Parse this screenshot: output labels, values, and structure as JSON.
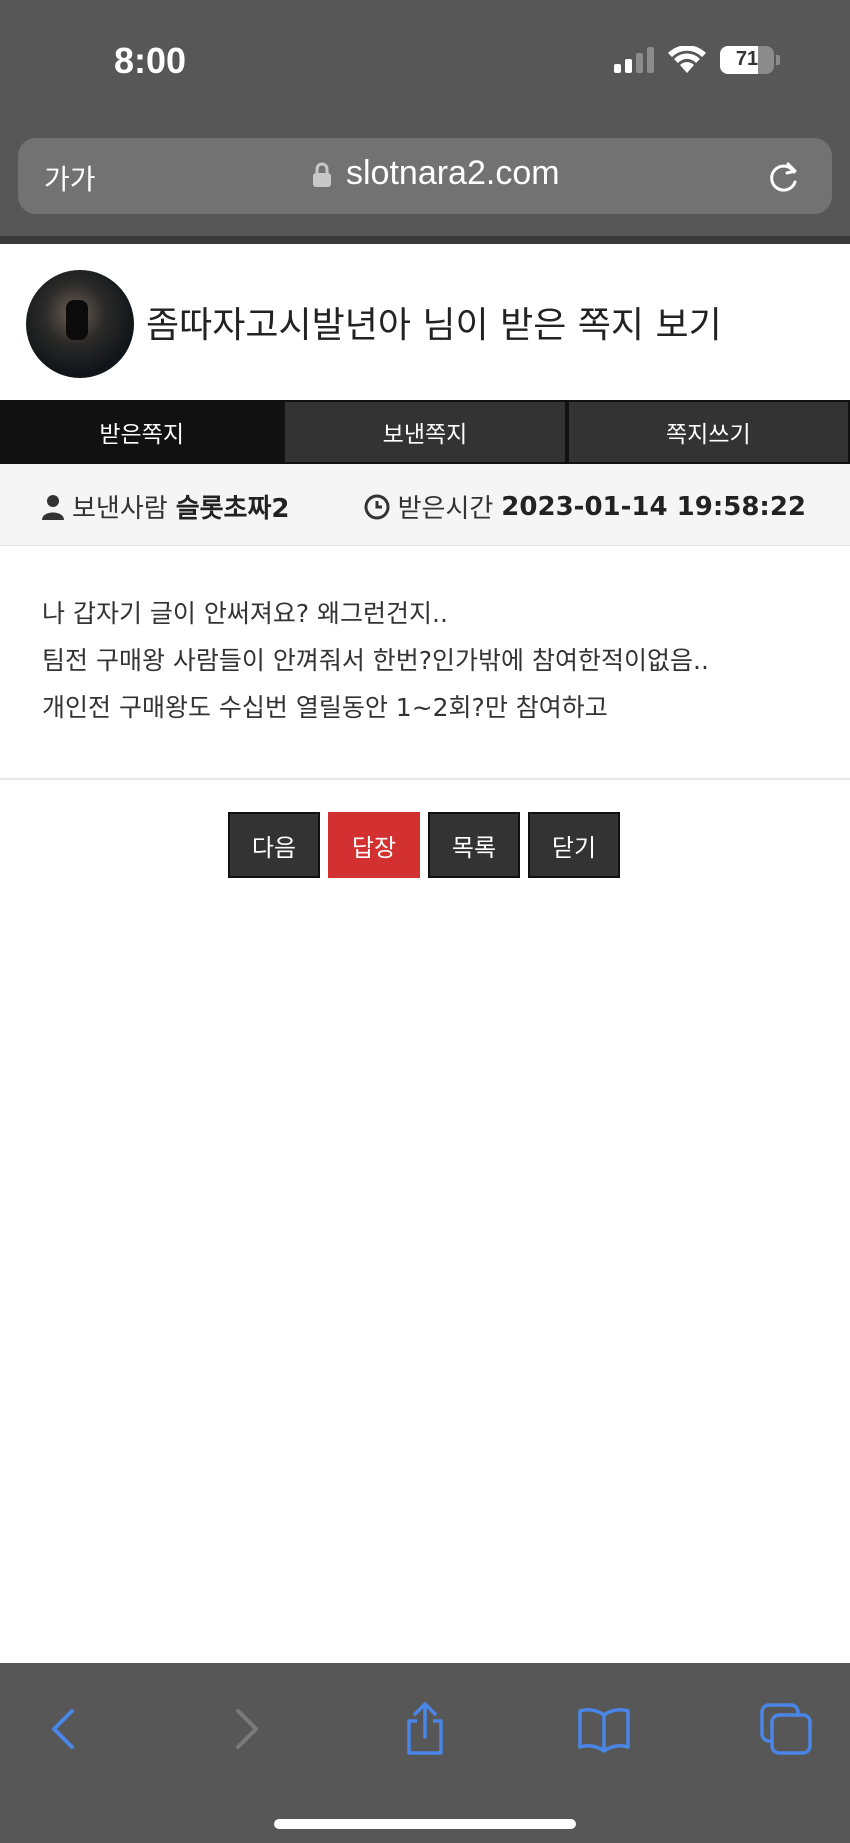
{
  "status_bar": {
    "time": "8:00",
    "battery": "71",
    "battery_level": 0.71
  },
  "address_bar": {
    "aa_label": "가가",
    "url": "slotnara2.com"
  },
  "header": {
    "title": "좀따자고시발년아 님이 받은 쪽지 보기"
  },
  "tabs": [
    {
      "label": "받은쪽지",
      "active": true
    },
    {
      "label": "보낸쪽지",
      "active": false
    },
    {
      "label": "쪽지쓰기",
      "active": false
    }
  ],
  "meta": {
    "sender_label": "보낸사람",
    "sender_name": "슬롯초짜2",
    "time_label": "받은시간",
    "time_value": "2023-01-14 19:58:22"
  },
  "message": {
    "lines": [
      "나 갑자기 글이 안써져요? 왜그런건지..",
      "팀전 구매왕 사람들이 안껴줘서 한번?인가밖에 참여한적이없음..",
      "개인전 구매왕도 수십번 열릴동안 1~2회?만 참여하고"
    ]
  },
  "actions": {
    "next_label": "다음",
    "reply_label": "답장",
    "list_label": "목록",
    "close_label": "닫기"
  },
  "colors": {
    "accent": "#d33131",
    "dark_button": "#333333",
    "ios_blue": "#4a86e8"
  },
  "toolbar_icons": [
    "back-icon",
    "forward-icon",
    "share-icon",
    "bookmarks-icon",
    "tabs-icon"
  ]
}
